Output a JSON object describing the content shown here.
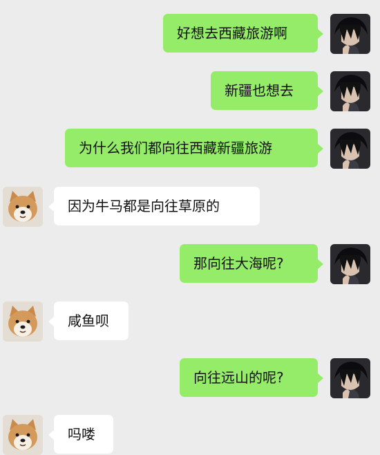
{
  "messages": [
    {
      "side": "me",
      "text": "好想去西藏旅游啊",
      "avatar": "anime-boy-avatar"
    },
    {
      "side": "me",
      "text": "新疆也想去",
      "avatar": "anime-boy-avatar"
    },
    {
      "side": "me",
      "text": "为什么我们都向往西藏新疆旅游",
      "avatar": "anime-boy-avatar"
    },
    {
      "side": "other",
      "text": "因为牛马都是向往草原的",
      "avatar": "shiba-dog-avatar"
    },
    {
      "side": "me",
      "text": "那向往大海呢?",
      "avatar": "anime-boy-avatar"
    },
    {
      "side": "other",
      "text": "咸鱼呗",
      "avatar": "shiba-dog-avatar"
    },
    {
      "side": "me",
      "text": "向往远山的呢?",
      "avatar": "anime-boy-avatar"
    },
    {
      "side": "other",
      "text": "吗喽",
      "avatar": "shiba-dog-avatar"
    }
  ],
  "colors": {
    "background": "#ececec",
    "my_bubble": "#95ec69",
    "their_bubble": "#ffffff"
  }
}
